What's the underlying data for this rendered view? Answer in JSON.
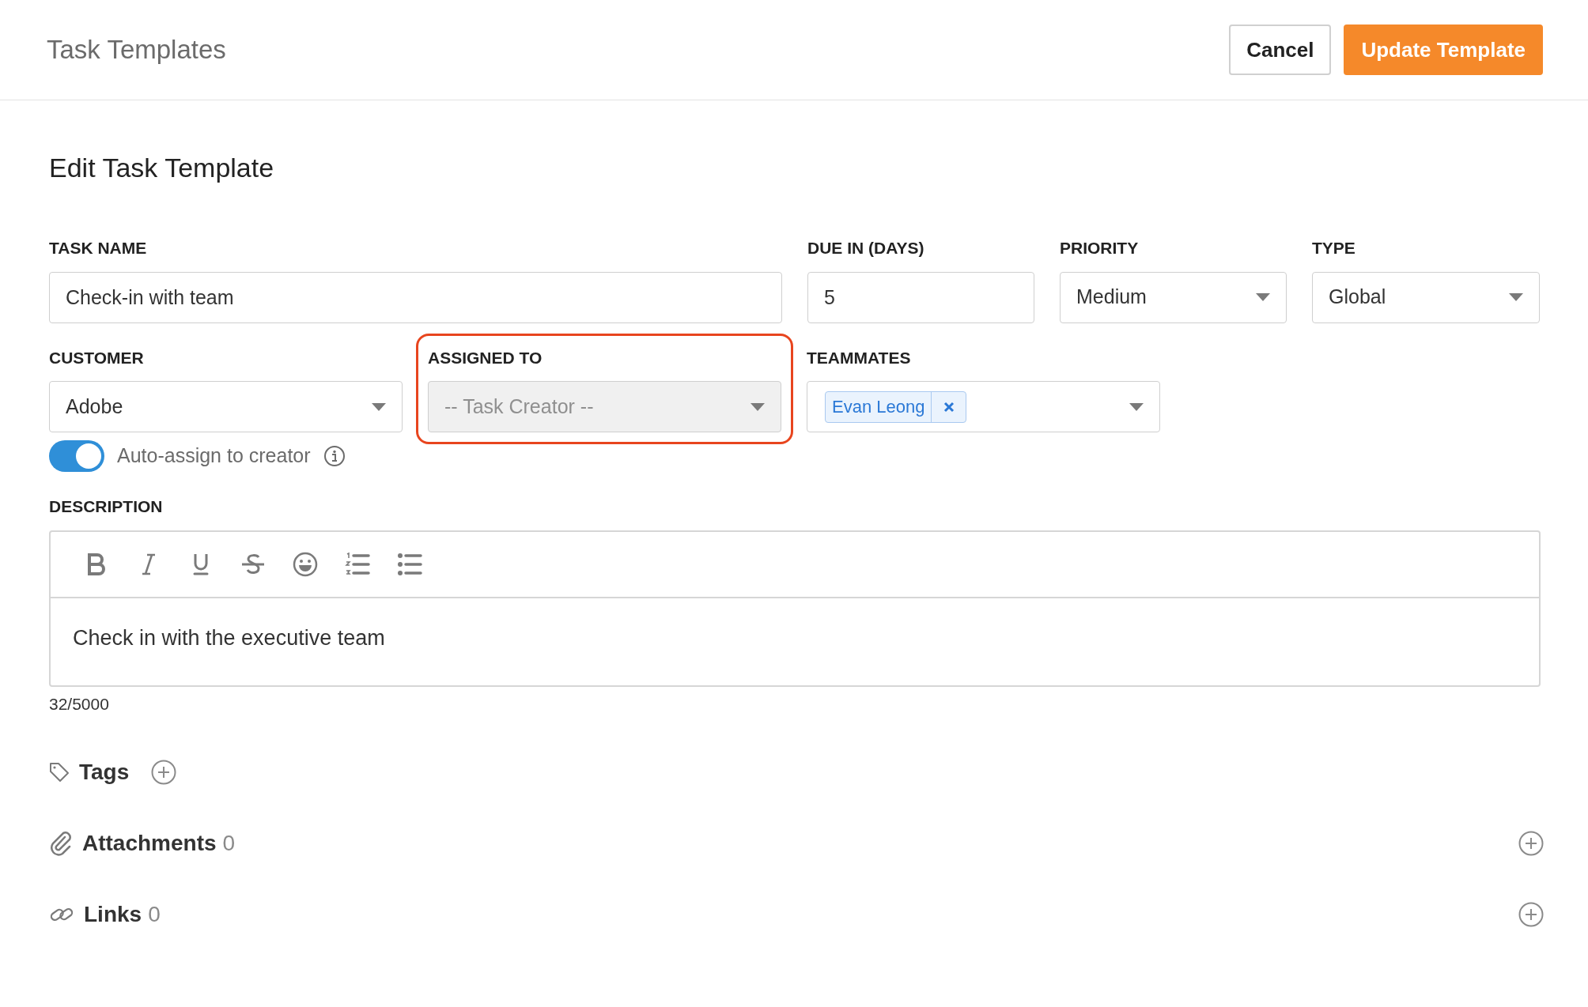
{
  "header": {
    "title": "Task Templates",
    "buttons": [
      {
        "label": "Cancel",
        "kind": "secondary"
      },
      {
        "label": "Update Template",
        "kind": "primary"
      }
    ]
  },
  "form_title": "Edit Task Template",
  "row_1": [
    {
      "label": "TASK NAME",
      "kind": "text",
      "value": "Check-in with team",
      "disabled": false,
      "highlighted": false
    },
    {
      "label": "DUE IN (DAYS)",
      "kind": "text",
      "value": "5",
      "disabled": false,
      "highlighted": false
    },
    {
      "label": "PRIORITY",
      "kind": "select",
      "value": "Medium",
      "disabled": false,
      "highlighted": false
    },
    {
      "label": "TYPE",
      "kind": "select",
      "value": "Global",
      "disabled": false,
      "highlighted": false
    }
  ],
  "row_2": [
    {
      "label": "CUSTOMER",
      "kind": "select",
      "value": "Adobe",
      "disabled": false,
      "highlighted": false
    },
    {
      "label": "ASSIGNED TO",
      "kind": "select",
      "value": "-- Task Creator --",
      "disabled": true,
      "highlighted": true
    },
    {
      "label": "TEAMMATES",
      "kind": "tags",
      "tags": [
        "Evan Leong"
      ],
      "disabled": false,
      "highlighted": false
    }
  ],
  "auto_assign": {
    "label": "Auto-assign to creator",
    "on": true
  },
  "description": {
    "label": "DESCRIPTION",
    "toolbar": [
      {
        "kind": "bold"
      },
      {
        "kind": "italic"
      },
      {
        "kind": "underline"
      },
      {
        "kind": "strikethrough"
      },
      {
        "kind": "emoji"
      },
      {
        "kind": "numbered-list"
      },
      {
        "kind": "bulleted-list"
      }
    ],
    "text": "Check in with the executive team",
    "counter": "32/5000"
  },
  "sections": [
    {
      "kind": "tags",
      "label": "Tags"
    },
    {
      "kind": "attachments",
      "label": "Attachments",
      "count": "0"
    },
    {
      "kind": "links",
      "label": "Links",
      "count": "0"
    }
  ]
}
